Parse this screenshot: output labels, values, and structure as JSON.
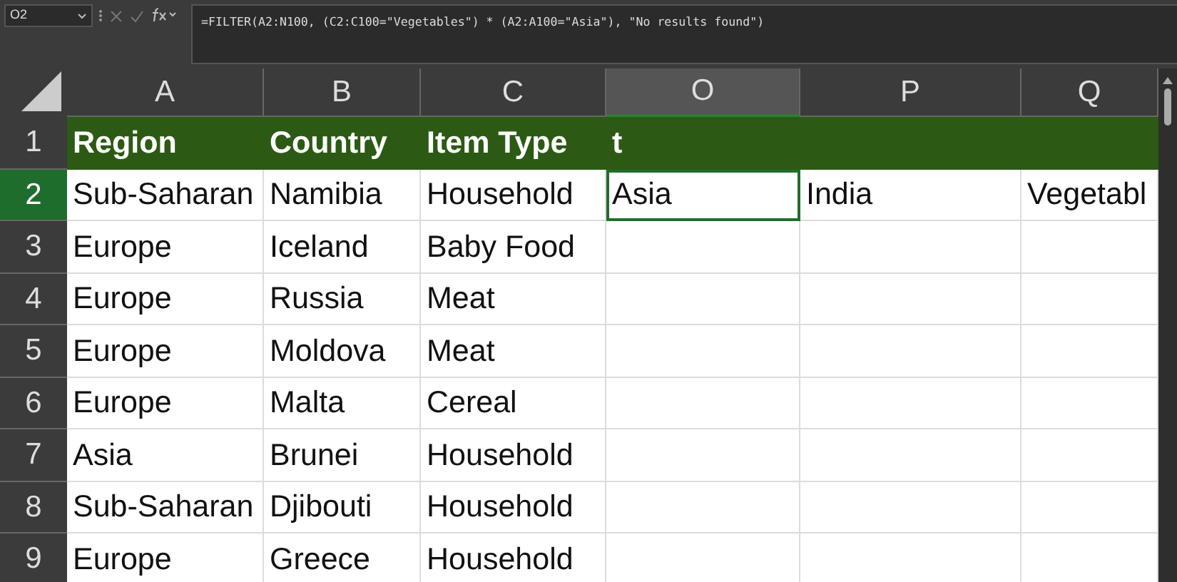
{
  "name_box": {
    "value": "O2"
  },
  "formula_bar": {
    "formula": "=FILTER(A2:N100, (C2:C100=\"Vegetables\") * (A2:A100=\"Asia\"), \"No results found\")"
  },
  "columns": [
    {
      "label": "A",
      "selected": false
    },
    {
      "label": "B",
      "selected": false
    },
    {
      "label": "C",
      "selected": false
    },
    {
      "label": "O",
      "selected": true
    },
    {
      "label": "P",
      "selected": false
    },
    {
      "label": "Q",
      "selected": false
    }
  ],
  "rows": [
    {
      "number": "1",
      "selected": false,
      "kind": "header",
      "cells": [
        "Region",
        "Country",
        "Item Type",
        "t",
        "",
        ""
      ]
    },
    {
      "number": "2",
      "selected": true,
      "kind": "data",
      "cells": [
        "Sub-Saharan",
        "Namibia",
        "Household",
        "Asia",
        "India",
        "Vegetabl"
      ]
    },
    {
      "number": "3",
      "selected": false,
      "kind": "data",
      "cells": [
        "Europe",
        "Iceland",
        "Baby Food",
        "",
        "",
        ""
      ]
    },
    {
      "number": "4",
      "selected": false,
      "kind": "data",
      "cells": [
        "Europe",
        "Russia",
        "Meat",
        "",
        "",
        ""
      ]
    },
    {
      "number": "5",
      "selected": false,
      "kind": "data",
      "cells": [
        "Europe",
        "Moldova",
        "Meat",
        "",
        "",
        ""
      ]
    },
    {
      "number": "6",
      "selected": false,
      "kind": "data",
      "cells": [
        "Europe",
        "Malta",
        "Cereal",
        "",
        "",
        ""
      ]
    },
    {
      "number": "7",
      "selected": false,
      "kind": "data",
      "cells": [
        "Asia",
        "Brunei",
        "Household",
        "",
        "",
        ""
      ]
    },
    {
      "number": "8",
      "selected": false,
      "kind": "data",
      "cells": [
        "Sub-Saharan",
        "Djibouti",
        "Household",
        "",
        "",
        ""
      ]
    },
    {
      "number": "9",
      "selected": false,
      "kind": "data",
      "cells": [
        "Europe",
        "Greece",
        "Household",
        "",
        "",
        ""
      ]
    }
  ]
}
